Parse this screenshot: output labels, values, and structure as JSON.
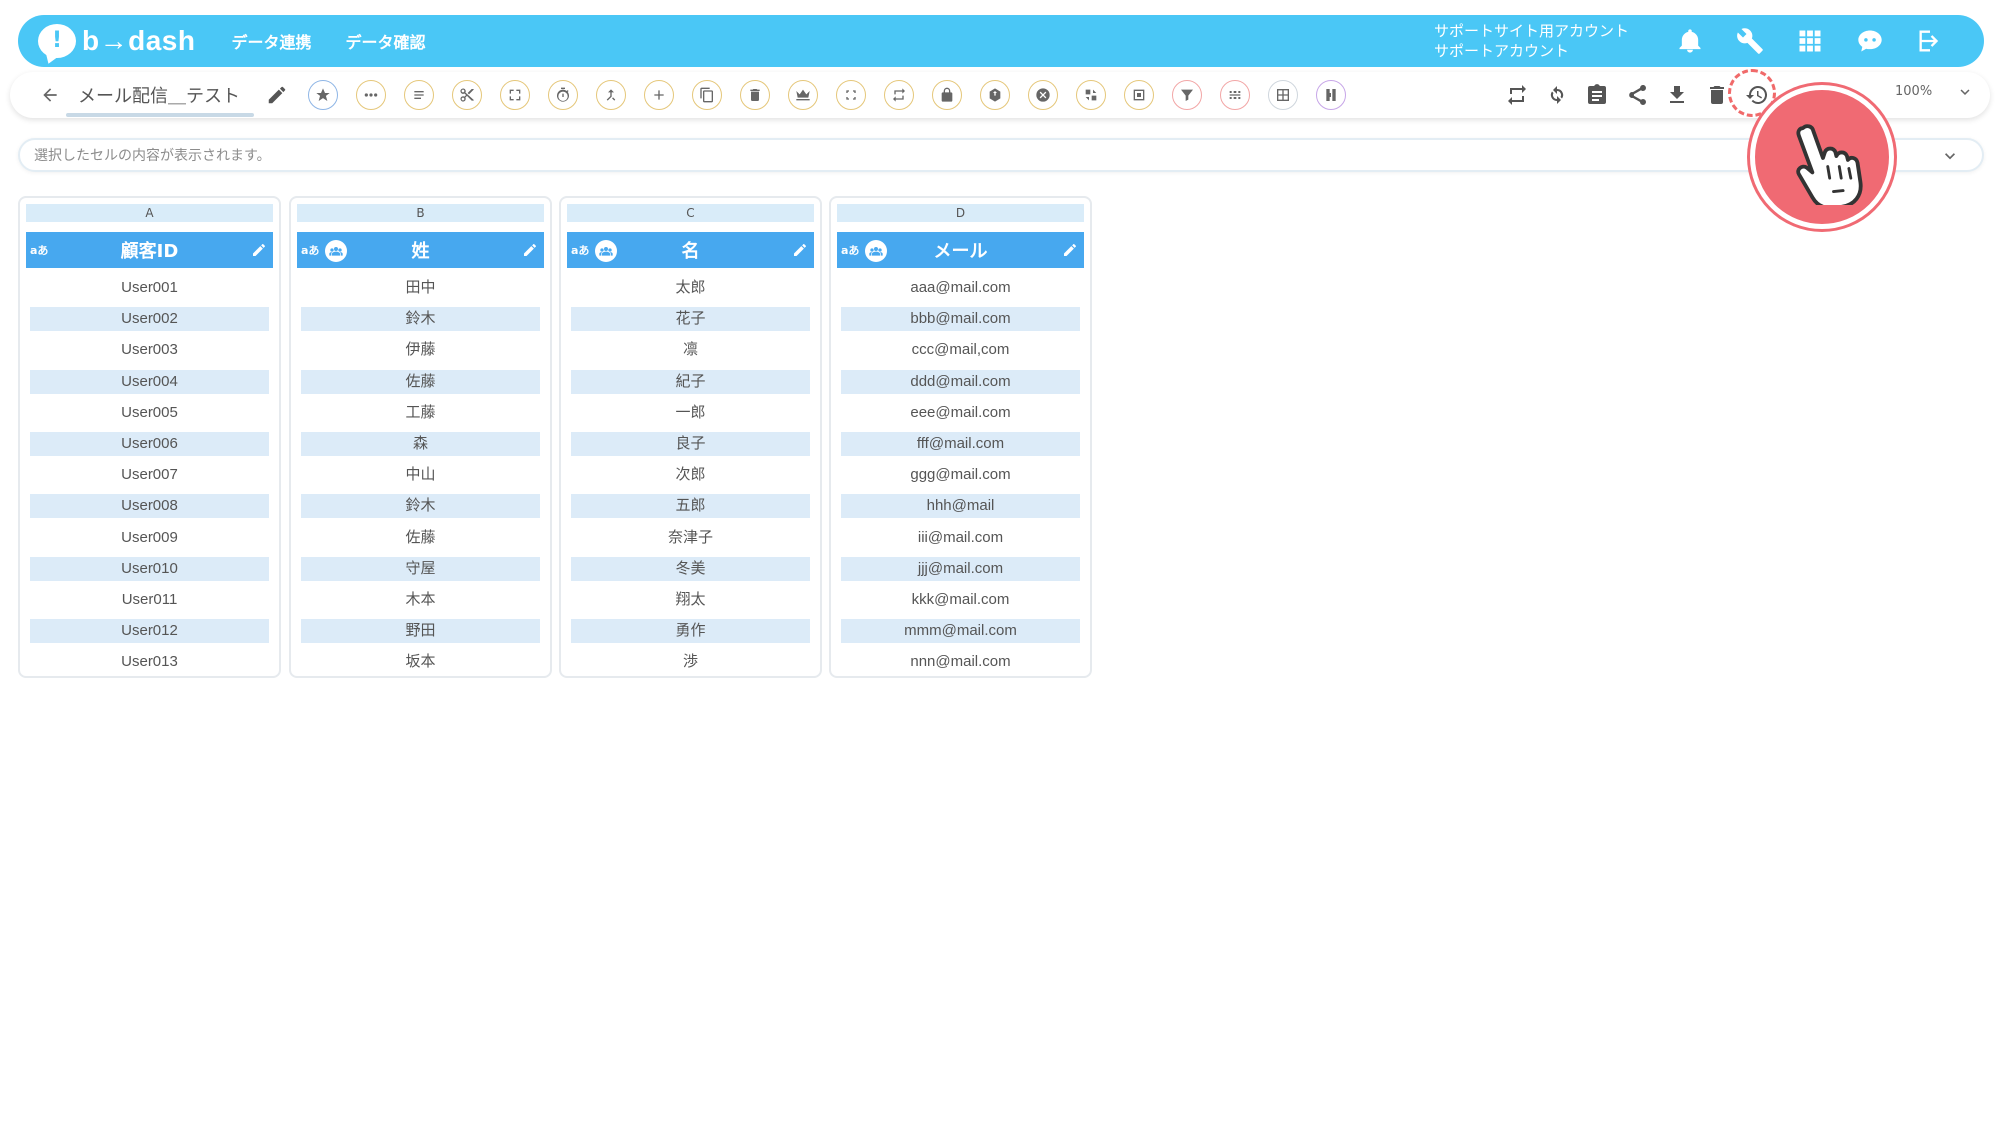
{
  "header": {
    "logo_mark": "!",
    "logo_text": "b→dash",
    "nav": [
      "データ連携",
      "データ確認"
    ],
    "account_line1": "サポートサイト用アカウント",
    "account_line2": "サポートアカウント"
  },
  "toolbar": {
    "title": "メール配信＿テスト",
    "zoom": "100%"
  },
  "cellbar": {
    "placeholder": "選択したセルの内容が表示されます。"
  },
  "columns": [
    {
      "letter": "A",
      "type_badge": "aあ",
      "name": "顧客ID",
      "has_people_icon": false,
      "rows": [
        "User001",
        "User002",
        "User003",
        "User004",
        "User005",
        "User006",
        "User007",
        "User008",
        "User009",
        "User010",
        "User011",
        "User012",
        "User013"
      ]
    },
    {
      "letter": "B",
      "type_badge": "aあ",
      "name": "姓",
      "has_people_icon": true,
      "rows": [
        "田中",
        "鈴木",
        "伊藤",
        "佐藤",
        "工藤",
        "森",
        "中山",
        "鈴木",
        "佐藤",
        "守屋",
        "木本",
        "野田",
        "坂本"
      ]
    },
    {
      "letter": "C",
      "type_badge": "aあ",
      "name": "名",
      "has_people_icon": true,
      "rows": [
        "太郎",
        "花子",
        "凛",
        "紀子",
        "一郎",
        "良子",
        "次郎",
        "五郎",
        "奈津子",
        "冬美",
        "翔太",
        "勇作",
        "渉"
      ]
    },
    {
      "letter": "D",
      "type_badge": "aあ",
      "name": "メール",
      "has_people_icon": true,
      "rows": [
        "aaa@mail.com",
        "bbb@mail.com",
        "ccc@mail,com",
        "ddd@mail.com",
        "eee@mail.com",
        "fff@mail.com",
        "ggg@mail.com",
        "hhh@mail",
        "iii@mail.com",
        "jjj@mail.com",
        "kkk@mail.com",
        "mmm@mail.com",
        "nnn@mail.com"
      ]
    }
  ],
  "colors": {
    "header": "#4ac7f6",
    "column_header": "#47a8ef",
    "row_alt": "#dcebf8",
    "highlight": "#f06a73"
  },
  "icons": {
    "header": [
      "bell-icon",
      "wrench-icon",
      "apps-grid-icon",
      "assistant-icon",
      "logout-icon"
    ],
    "tools": [
      "star-icon",
      "more-icon",
      "text-icon",
      "cut-icon",
      "transform-icon",
      "timer-icon",
      "merge-icon",
      "add-icon",
      "copy-icon",
      "delete-icon",
      "crown-icon",
      "expand-icon",
      "repeat-icon",
      "lock-icon",
      "upload-icon",
      "cancel-icon",
      "convert-icon",
      "frame-icon",
      "filter-icon",
      "pattern-icon",
      "table-icon",
      "column-icon"
    ],
    "right": [
      "swap-icon",
      "refresh-icon",
      "clipboard-icon",
      "share-icon",
      "download-icon",
      "trash-icon",
      "history-icon",
      "export-icon"
    ]
  }
}
